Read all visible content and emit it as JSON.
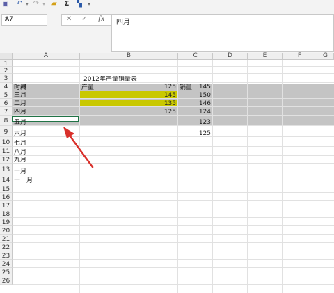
{
  "name_box": "A7",
  "formula_value": "四月",
  "formula_icons": [
    "cancel-icon",
    "confirm-icon",
    "fx-icon"
  ],
  "qat_icons": [
    "save-icon",
    "undo-icon",
    "redo-icon",
    "open-folder-icon",
    "autosum-icon",
    "format-icon",
    "customize-icon"
  ],
  "columns": [
    "A",
    "B",
    "C",
    "D",
    "E",
    "F",
    "G"
  ],
  "row_numbers": [
    "1",
    "2",
    "3",
    "4",
    "5",
    "6",
    "7",
    "8",
    "9",
    "10",
    "11",
    "12",
    "13",
    "14",
    "15",
    "16",
    "17",
    "18",
    "19",
    "20",
    "21",
    "22",
    "23",
    "24",
    "25",
    "26"
  ],
  "title": "2012年产量销量表",
  "headers": {
    "col_a": "时间",
    "col_b": "产量",
    "col_c": "销量"
  },
  "rows": [
    {
      "month": "一月",
      "output": "125",
      "sales": "145"
    },
    {
      "month": "三月",
      "output": "145",
      "sales": "150"
    },
    {
      "month": "二月",
      "output": "135",
      "sales": "146"
    },
    {
      "month": "四月",
      "output": "125",
      "sales": "124"
    },
    {
      "month": "五月",
      "output": "",
      "sales": "123"
    },
    {
      "month": "六月",
      "output": "",
      "sales": "125"
    },
    {
      "month": "七月",
      "output": "",
      "sales": ""
    },
    {
      "month": "八月",
      "output": "",
      "sales": ""
    },
    {
      "month": "九月",
      "output": "",
      "sales": ""
    },
    {
      "month": "十月",
      "output": "",
      "sales": ""
    },
    {
      "month": "十一月",
      "output": "",
      "sales": ""
    }
  ],
  "colors": {
    "highlight_gray": "#c4c4c4",
    "highlight_yellow": "#c9c800",
    "arrow": "#d9302b",
    "selection": "#217346"
  }
}
